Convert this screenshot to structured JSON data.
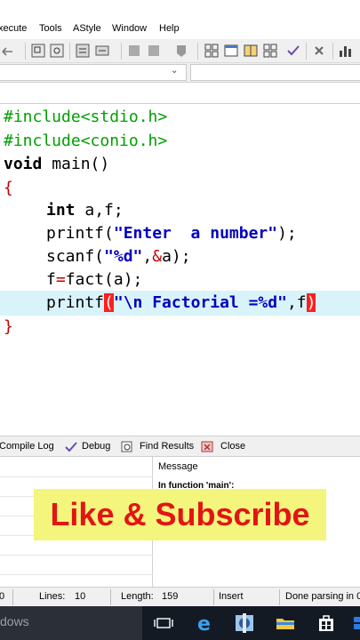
{
  "menu": {
    "items": [
      "xecute",
      "Tools",
      "AStyle",
      "Window",
      "Help"
    ]
  },
  "toolbar": {
    "icons": [
      "undo-icon",
      "compile-icon",
      "run-icon",
      "compile-run-icon",
      "rebuild-icon",
      "debug-icon",
      "new-class-icon",
      "check-icon",
      "stop-icon",
      "chart-icon"
    ]
  },
  "editor": {
    "lines": [
      "#include<stdio.h>",
      "#include<conio.h>",
      "void main()",
      "{",
      "int a,f;",
      "printf(\"Enter  a number\");",
      "scanf(\"%d\",&a);",
      "f=fact(a);",
      "printf(\"\\n Factorial =%d\",f)",
      "}"
    ],
    "tokens": {
      "l1": "#include<stdio.h>",
      "l2": "#include<conio.h>",
      "l3_kw": "void",
      "l3_rest": " main()",
      "l4": "{",
      "l5_kw": "int",
      "l5_rest": " a,f;",
      "l6_fn": "printf(",
      "l6_str": "\"Enter  a number\"",
      "l6_end": ");",
      "l7_fn": "scanf(",
      "l7_str": "\"%d\"",
      "l7_mid": ",",
      "l7_amp": "&",
      "l7_end": "a);",
      "l8_a": "f",
      "l8_eq": "=",
      "l8_b": "fact(a);",
      "l9_fn": "printf",
      "l9_br": "(",
      "l9_str": "\"\\n Factorial =%d\"",
      "l9_mid": ",f",
      "l9_br2": ")",
      "l10": "}"
    }
  },
  "tabs": {
    "compile_log": "Compile Log",
    "debug": "Debug",
    "find_results": "Find Results",
    "close": "Close"
  },
  "panel": {
    "message_header": "Message",
    "message_line": "In function 'main':"
  },
  "banner": {
    "text": "Like & Subscribe"
  },
  "status": {
    "col": "0",
    "lines_label": "Lines:",
    "lines_value": "10",
    "length_label": "Length:",
    "length_value": "159",
    "mode": "Insert",
    "parse": "Done parsing in 0"
  },
  "taskbar": {
    "search_text": "dows"
  },
  "colors": {
    "highlight_line": "#d9f3fb",
    "banner_bg": "#f4f57c",
    "banner_text": "#e31414",
    "preprocessor": "#00a000",
    "string": "#0000c0",
    "bracket_match": "#ff1f1f"
  }
}
